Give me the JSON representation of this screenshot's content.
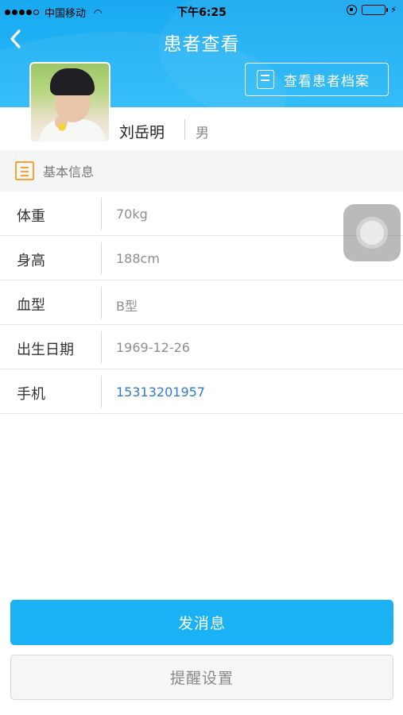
{
  "status_bar": {
    "carrier": "中国移动",
    "time": "下午6:25"
  },
  "header": {
    "title": "患者查看",
    "archive_button": "查看患者档案"
  },
  "patient": {
    "name": "刘岳明",
    "gender": "男"
  },
  "section": {
    "title": "基本信息"
  },
  "info_rows": [
    {
      "label": "体重",
      "value": "70kg"
    },
    {
      "label": "身高",
      "value": "188cm"
    },
    {
      "label": "血型",
      "value": "B型"
    },
    {
      "label": "出生日期",
      "value": "1969-12-26"
    },
    {
      "label": "手机",
      "value": "15313201957"
    }
  ],
  "actions": {
    "send_message": "发消息",
    "reminder_settings": "提醒设置"
  },
  "colors": {
    "header_blue": "#1aa9f0",
    "primary_button": "#1ab2f5",
    "phone_link": "#2f7bd3",
    "section_icon": "#f5a431",
    "battery": "#4cd964"
  },
  "icons": {
    "back": "chevron-left-icon",
    "archive": "document-icon",
    "section": "list-icon",
    "assistive_touch": "assistive-touch-icon"
  }
}
